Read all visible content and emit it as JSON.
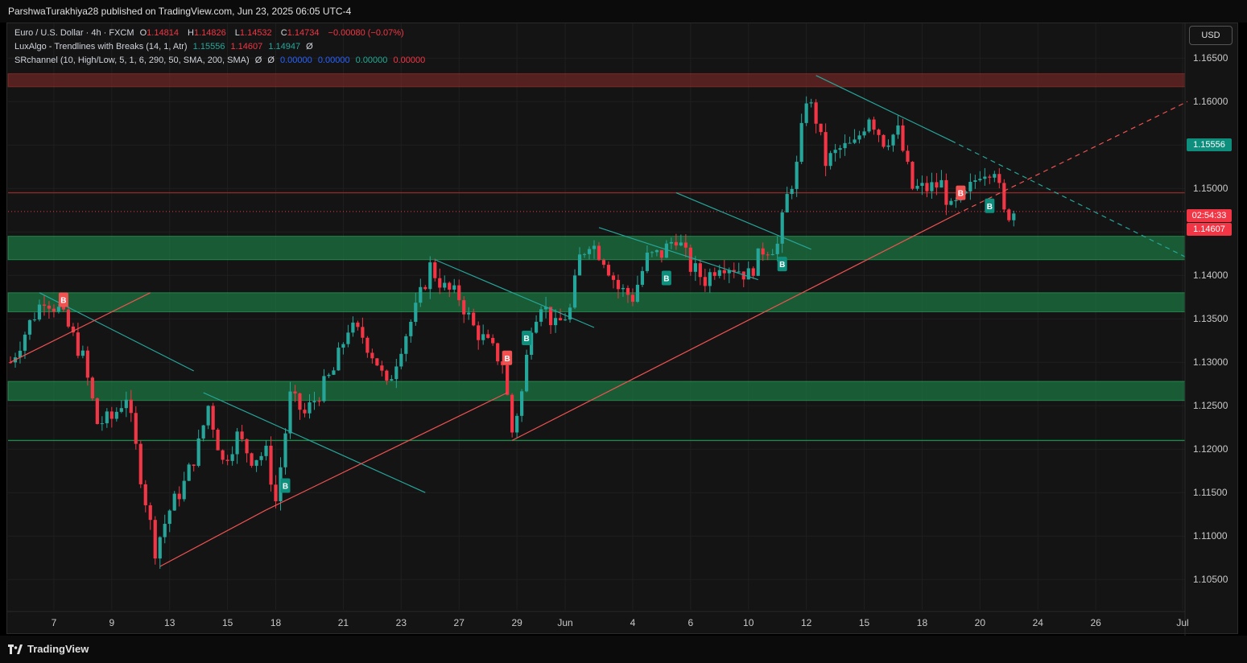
{
  "publisher": "ParshwaTurakhiya28 published on TradingView.com, Jun 23, 2025 06:05 UTC-4",
  "legend": {
    "symbol": "Euro / U.S. Dollar · 4h · FXCM",
    "ohlc": [
      {
        "label": "O",
        "value": "1.14814"
      },
      {
        "label": "H",
        "value": "1.14826"
      },
      {
        "label": "L",
        "value": "1.14532"
      },
      {
        "label": "C",
        "value": "1.14734"
      }
    ],
    "change": "−0.00080 (−0.07%)",
    "indicator1_name": "LuxAlgo - Trendlines with Breaks (14, 1, Atr)",
    "indicator1_values": [
      "1.15556",
      "1.14607",
      "1.14947",
      "Ø"
    ],
    "indicator2_name": "SRchannel (10, High/Low, 5, 1, 6, 290, 50, SMA, 200, SMA)",
    "indicator2_values": [
      "Ø",
      "Ø",
      "0.00000",
      "0.00000",
      "0.00000",
      "0.00000"
    ]
  },
  "currency_button": "USD",
  "price_tags": {
    "trendline": "1.15556",
    "countdown": "02:54:33",
    "last": "1.14607"
  },
  "footer_brand": "TradingView",
  "colors": {
    "up": "#26a69a",
    "down": "#f23645",
    "zone_green": "#1b8a4a",
    "zone_red": "#8b2a2a",
    "trend_teal": "#26a69a",
    "trend_red": "#f05252"
  },
  "chart_data": {
    "type": "candlestick",
    "timeframe": "4h",
    "y_range": [
      1.1015,
      1.169
    ],
    "y_ticks": [
      "1.16500",
      "1.16000",
      "1.15500",
      "1.15000",
      "1.14500",
      "1.14000",
      "1.13500",
      "1.13000",
      "1.12500",
      "1.12000",
      "1.11500",
      "1.11000",
      "1.10500"
    ],
    "x_ticks": [
      {
        "label": "7",
        "i": 9
      },
      {
        "label": "9",
        "i": 21
      },
      {
        "label": "13",
        "i": 33
      },
      {
        "label": "15",
        "i": 45
      },
      {
        "label": "18",
        "i": 55
      },
      {
        "label": "21",
        "i": 69
      },
      {
        "label": "23",
        "i": 81
      },
      {
        "label": "27",
        "i": 93
      },
      {
        "label": "29",
        "i": 105
      },
      {
        "label": "Jun",
        "i": 115
      },
      {
        "label": "4",
        "i": 129
      },
      {
        "label": "6",
        "i": 141
      },
      {
        "label": "10",
        "i": 153
      },
      {
        "label": "12",
        "i": 165
      },
      {
        "label": "15",
        "i": 177
      },
      {
        "label": "18",
        "i": 189
      },
      {
        "label": "20",
        "i": 201
      },
      {
        "label": "24",
        "i": 213
      },
      {
        "label": "26",
        "i": 225
      },
      {
        "label": "Jul",
        "i": 243
      }
    ],
    "bars_visible": 244,
    "zones": [
      {
        "type": "resistance",
        "top": 1.1632,
        "bottom": 1.1617
      },
      {
        "type": "support",
        "top": 1.1445,
        "bottom": 1.1418
      },
      {
        "type": "support",
        "top": 1.138,
        "bottom": 1.1358
      },
      {
        "type": "support",
        "top": 1.1278,
        "bottom": 1.1256
      }
    ],
    "level_lines": [
      1.1495,
      1.121
    ],
    "current_price_line": 1.14734,
    "candle_anchors": [
      {
        "i": 0,
        "p": 1.13
      },
      {
        "i": 4,
        "p": 1.1345
      },
      {
        "i": 7,
        "p": 1.1375
      },
      {
        "i": 10,
        "p": 1.136
      },
      {
        "i": 12,
        "p": 1.134
      },
      {
        "i": 15,
        "p": 1.1305
      },
      {
        "i": 18,
        "p": 1.123
      },
      {
        "i": 21,
        "p": 1.1235
      },
      {
        "i": 24,
        "p": 1.1262
      },
      {
        "i": 27,
        "p": 1.117
      },
      {
        "i": 30,
        "p": 1.1085
      },
      {
        "i": 33,
        "p": 1.113
      },
      {
        "i": 36,
        "p": 1.116
      },
      {
        "i": 39,
        "p": 1.1205
      },
      {
        "i": 41,
        "p": 1.125
      },
      {
        "i": 44,
        "p": 1.1185
      },
      {
        "i": 47,
        "p": 1.1215
      },
      {
        "i": 50,
        "p": 1.119
      },
      {
        "i": 53,
        "p": 1.1195
      },
      {
        "i": 55,
        "p": 1.114
      },
      {
        "i": 58,
        "p": 1.126
      },
      {
        "i": 61,
        "p": 1.124
      },
      {
        "i": 64,
        "p": 1.1265
      },
      {
        "i": 67,
        "p": 1.129
      },
      {
        "i": 70,
        "p": 1.134
      },
      {
        "i": 73,
        "p": 1.133
      },
      {
        "i": 76,
        "p": 1.13
      },
      {
        "i": 78,
        "p": 1.127
      },
      {
        "i": 81,
        "p": 1.132
      },
      {
        "i": 84,
        "p": 1.136
      },
      {
        "i": 87,
        "p": 1.141
      },
      {
        "i": 90,
        "p": 1.1385
      },
      {
        "i": 93,
        "p": 1.1375
      },
      {
        "i": 96,
        "p": 1.134
      },
      {
        "i": 99,
        "p": 1.132
      },
      {
        "i": 102,
        "p": 1.13
      },
      {
        "i": 104,
        "p": 1.122
      },
      {
        "i": 106,
        "p": 1.1265
      },
      {
        "i": 108,
        "p": 1.1345
      },
      {
        "i": 110,
        "p": 1.137
      },
      {
        "i": 113,
        "p": 1.134
      },
      {
        "i": 116,
        "p": 1.136
      },
      {
        "i": 118,
        "p": 1.142
      },
      {
        "i": 120,
        "p": 1.144
      },
      {
        "i": 123,
        "p": 1.142
      },
      {
        "i": 126,
        "p": 1.1385
      },
      {
        "i": 129,
        "p": 1.1375
      },
      {
        "i": 132,
        "p": 1.142
      },
      {
        "i": 135,
        "p": 1.1425
      },
      {
        "i": 138,
        "p": 1.1445
      },
      {
        "i": 141,
        "p": 1.141
      },
      {
        "i": 144,
        "p": 1.1395
      },
      {
        "i": 147,
        "p": 1.1415
      },
      {
        "i": 150,
        "p": 1.141
      },
      {
        "i": 153,
        "p": 1.14
      },
      {
        "i": 156,
        "p": 1.143
      },
      {
        "i": 159,
        "p": 1.1435
      },
      {
        "i": 161,
        "p": 1.149
      },
      {
        "i": 163,
        "p": 1.1525
      },
      {
        "i": 165,
        "p": 1.1605
      },
      {
        "i": 167,
        "p": 1.158
      },
      {
        "i": 169,
        "p": 1.153
      },
      {
        "i": 172,
        "p": 1.1545
      },
      {
        "i": 175,
        "p": 1.155
      },
      {
        "i": 178,
        "p": 1.1585
      },
      {
        "i": 181,
        "p": 1.1555
      },
      {
        "i": 184,
        "p": 1.1565
      },
      {
        "i": 187,
        "p": 1.15
      },
      {
        "i": 190,
        "p": 1.15
      },
      {
        "i": 193,
        "p": 1.1505
      },
      {
        "i": 195,
        "p": 1.1475
      },
      {
        "i": 198,
        "p": 1.149
      },
      {
        "i": 201,
        "p": 1.152
      },
      {
        "i": 204,
        "p": 1.1525
      },
      {
        "i": 206,
        "p": 1.147
      },
      {
        "i": 208,
        "p": 1.14734
      }
    ],
    "trendlines": [
      {
        "color": "teal",
        "from": [
          1.138,
          6
        ],
        "to": [
          1.129,
          38
        ],
        "dashed": false
      },
      {
        "color": "red",
        "from": [
          1.13,
          0
        ],
        "to": [
          1.138,
          29
        ],
        "dashed": false
      },
      {
        "color": "teal",
        "from": [
          1.1265,
          40
        ],
        "to": [
          1.115,
          86
        ],
        "dashed": false
      },
      {
        "color": "red",
        "from": [
          1.1065,
          31
        ],
        "to": [
          1.113,
          53
        ],
        "dashed": false
      },
      {
        "color": "red",
        "from": [
          1.113,
          53
        ],
        "to": [
          1.1265,
          103
        ],
        "dashed": false
      },
      {
        "color": "teal",
        "from": [
          1.1418,
          88
        ],
        "to": [
          1.134,
          121
        ],
        "dashed": false
      },
      {
        "color": "teal",
        "from": [
          1.1455,
          122
        ],
        "to": [
          1.1395,
          155
        ],
        "dashed": false
      },
      {
        "color": "teal",
        "from": [
          1.1495,
          138
        ],
        "to": [
          1.143,
          166
        ],
        "dashed": false
      },
      {
        "color": "red",
        "from": [
          1.121,
          104
        ],
        "to": [
          1.147,
          196
        ],
        "dashed": false
      },
      {
        "color": "red",
        "from": [
          1.147,
          196
        ],
        "to": [
          1.16,
          244
        ],
        "dashed": true
      },
      {
        "color": "teal",
        "from": [
          1.163,
          167
        ],
        "to": [
          1.1555,
          195
        ],
        "dashed": false
      },
      {
        "color": "teal",
        "from": [
          1.1555,
          195
        ],
        "to": [
          1.142,
          244
        ],
        "dashed": true
      }
    ],
    "signals": [
      {
        "label": "B",
        "kind": "bearish",
        "i": 11,
        "p": 1.1372
      },
      {
        "label": "B",
        "kind": "bullish",
        "i": 57,
        "p": 1.1158
      },
      {
        "label": "B",
        "kind": "bearish",
        "i": 103,
        "p": 1.1305
      },
      {
        "label": "B",
        "kind": "bullish",
        "i": 107,
        "p": 1.1328
      },
      {
        "label": "B",
        "kind": "bullish",
        "i": 136,
        "p": 1.1397
      },
      {
        "label": "B",
        "kind": "bullish",
        "i": 160,
        "p": 1.1413
      },
      {
        "label": "B",
        "kind": "bearish",
        "i": 197,
        "p": 1.1495
      },
      {
        "label": "B",
        "kind": "bullish",
        "i": 203,
        "p": 1.148
      }
    ]
  }
}
